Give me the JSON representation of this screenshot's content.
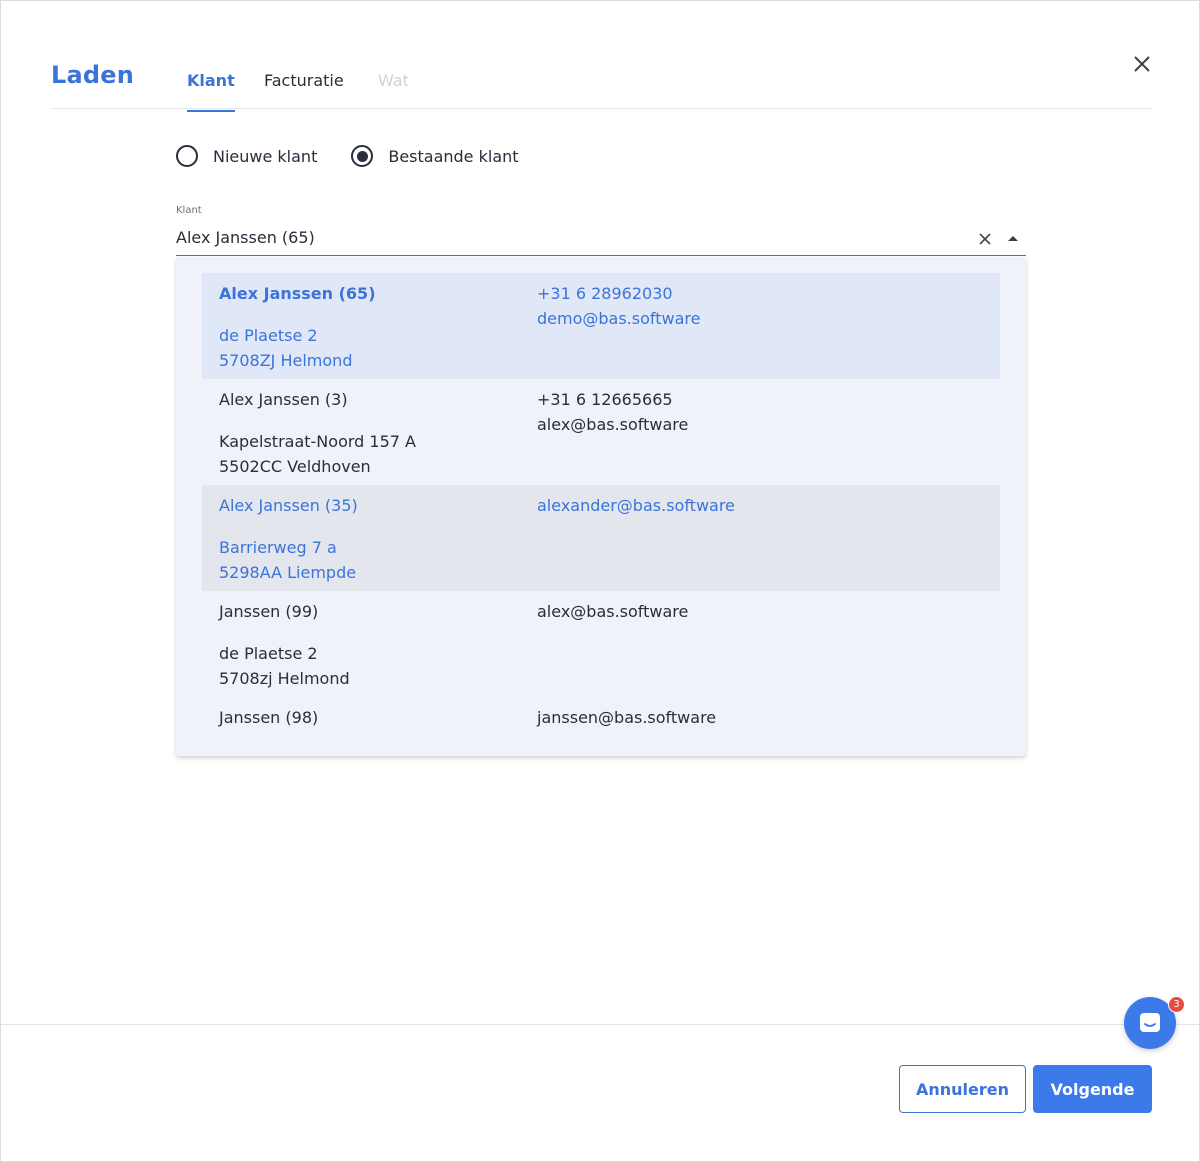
{
  "header": {
    "title": "Laden",
    "tabs": [
      {
        "label": "Klant",
        "state": "active"
      },
      {
        "label": "Facturatie",
        "state": "normal"
      },
      {
        "label": "Wat",
        "state": "disabled"
      }
    ]
  },
  "customer_type": {
    "options": [
      {
        "label": "Nieuwe klant",
        "selected": false
      },
      {
        "label": "Bestaande klant",
        "selected": true
      }
    ]
  },
  "customer_field": {
    "label": "Klant",
    "value": "Alex Janssen (65)"
  },
  "dropdown": {
    "options": [
      {
        "name": "Alex Janssen (65)",
        "street": "de Plaetse 2",
        "city": "5708ZJ Helmond",
        "phone": "+31 6 28962030",
        "email": "demo@bas.software",
        "state": "selected"
      },
      {
        "name": "Alex Janssen (3)",
        "street": "Kapelstraat-Noord 157 A",
        "city": "5502CC Veldhoven",
        "phone": "+31 6 12665665",
        "email": "alex@bas.software",
        "state": "normal"
      },
      {
        "name": "Alex Janssen (35)",
        "street": "Barrierweg 7 a",
        "city": "5298AA Liempde",
        "phone": "",
        "email": "alexander@bas.software",
        "state": "hover"
      },
      {
        "name": "Janssen (99)",
        "street": "de Plaetse 2",
        "city": "5708zj Helmond",
        "phone": "",
        "email": "alex@bas.software",
        "state": "normal"
      },
      {
        "name": "Janssen (98)",
        "street": "",
        "city": "",
        "phone": "",
        "email": "janssen@bas.software",
        "state": "normal"
      }
    ]
  },
  "footer": {
    "cancel_label": "Annuleren",
    "next_label": "Volgende"
  },
  "chat": {
    "badge_count": "3"
  },
  "colors": {
    "accent": "#3b73d9",
    "primary_button": "#3b7ae8",
    "badge": "#e74c3c"
  }
}
